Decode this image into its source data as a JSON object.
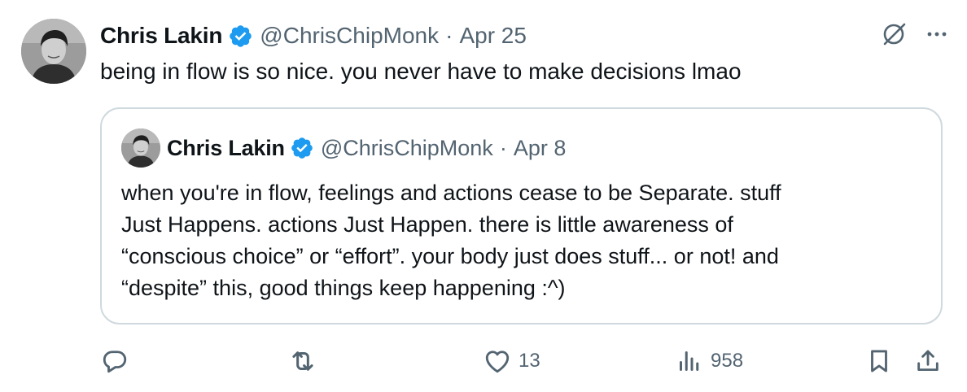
{
  "tweet": {
    "author_name": "Chris Lakin",
    "handle": "@ChrisChipMonk",
    "separator": "·",
    "date": "Apr 25",
    "text": "being in flow is so nice. you never have to make decisions lmao"
  },
  "quoted_tweet": {
    "author_name": "Chris Lakin",
    "handle": "@ChrisChipMonk",
    "separator": "·",
    "date": "Apr 8",
    "text": "when you're in flow, feelings and actions cease to be Separate. stuff\nJust Happens. actions Just Happen. there is little awareness of\n“conscious choice” or “effort”. your body just does stuff... or not! and\n“despite” this, good things keep happening :^)"
  },
  "actions": {
    "reply_count": "",
    "retweet_count": "",
    "like_count": "13",
    "view_count": "958"
  },
  "colors": {
    "text": "#0f1419",
    "secondary": "#536471",
    "verified": "#1d9bf0",
    "border": "#cfd9de"
  },
  "icons": {
    "verified": "verified-badge-icon",
    "grok": "grok-icon",
    "more": "more-dots-icon",
    "reply": "reply-icon",
    "retweet": "retweet-icon",
    "like": "heart-icon",
    "views": "views-icon",
    "bookmark": "bookmark-icon",
    "share": "share-icon"
  }
}
